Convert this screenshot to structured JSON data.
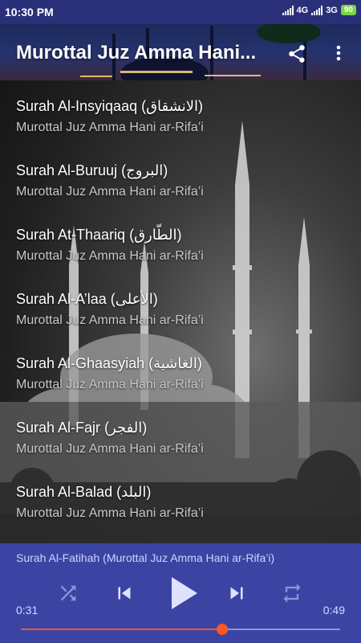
{
  "status_bar": {
    "time": "10:30 PM",
    "network1": "4G",
    "network2": "3G",
    "battery": "90"
  },
  "header": {
    "title": "Murottal Juz Amma Hani...",
    "share_icon": "share-icon",
    "more_icon": "more-vert-icon"
  },
  "list": {
    "items": [
      {
        "title": "Surah Al-Insyiqaaq (الانشقاق)",
        "subtitle": "Murottal Juz Amma Hani ar-Rifa’i"
      },
      {
        "title": "Surah Al-Buruuj (البروج)",
        "subtitle": "Murottal Juz Amma Hani ar-Rifa’i"
      },
      {
        "title": "Surah At-Thaariq (الطّارق)",
        "subtitle": "Murottal Juz Amma Hani ar-Rifa’i"
      },
      {
        "title": "Surah Al-A’laa (الأعلى)",
        "subtitle": "Murottal Juz Amma Hani ar-Rifa’i"
      },
      {
        "title": "Surah Al-Ghaasyiah (الغاشية)",
        "subtitle": "Murottal Juz Amma Hani ar-Rifa’i"
      },
      {
        "title": "Surah Al-Fajr (الفجر)",
        "subtitle": "Murottal Juz Amma Hani ar-Rifa’i"
      },
      {
        "title": "Surah Al-Balad (البلد)",
        "subtitle": "Murottal Juz Amma Hani ar-Rifa’i"
      }
    ]
  },
  "player": {
    "now_playing": "Surah Al-Fatihah (Murottal Juz Amma Hani ar-Rifa’i)",
    "elapsed": "0:31",
    "duration": "0:49",
    "progress_fraction": 0.63,
    "icons": [
      "shuffle-icon",
      "skip-previous-icon",
      "play-icon",
      "skip-next-icon",
      "repeat-icon"
    ]
  },
  "colors": {
    "status_bar": "#2a2f7a",
    "player_bg": "#3c44a3",
    "accent": "#ff5722"
  }
}
